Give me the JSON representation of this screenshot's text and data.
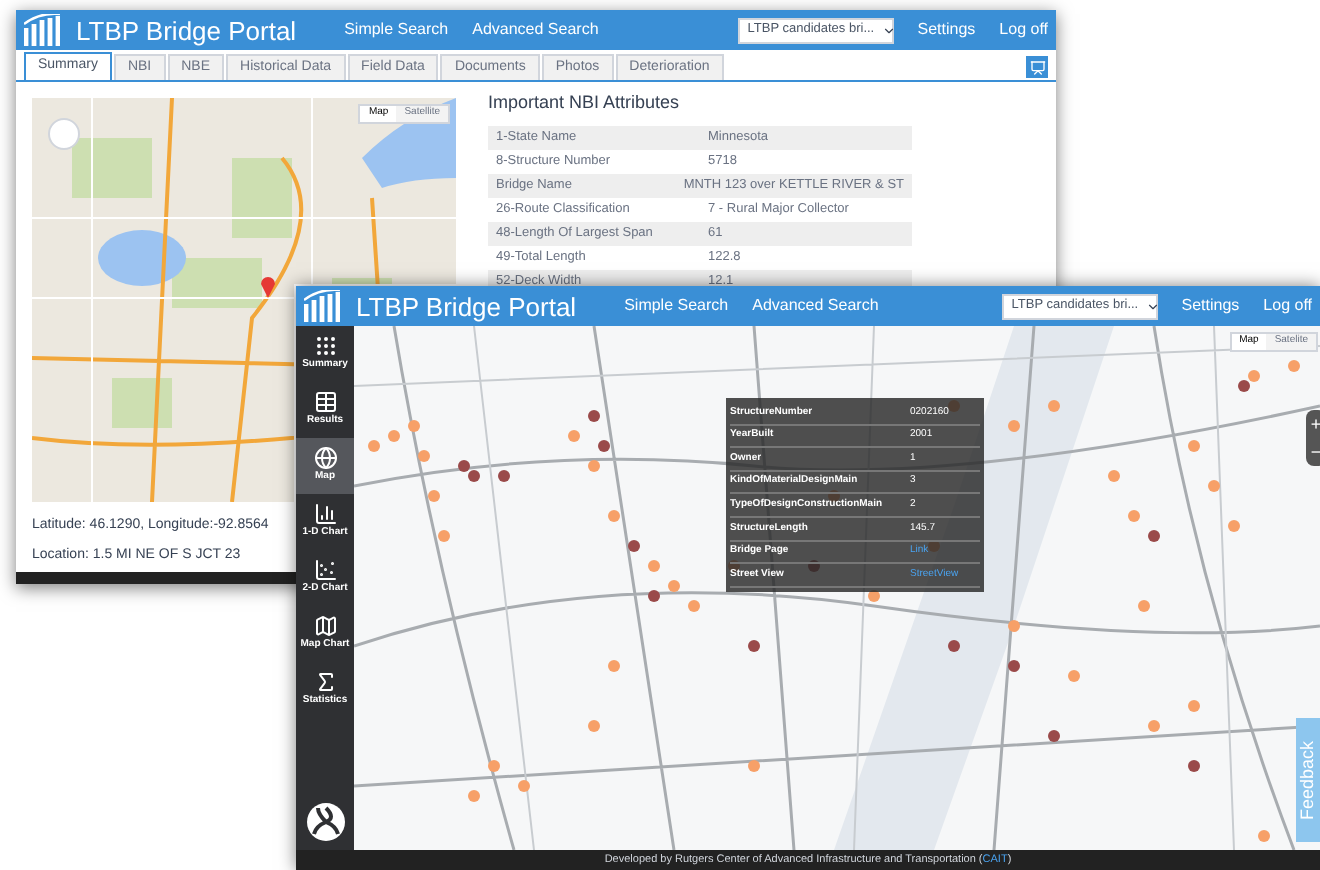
{
  "back_window": {
    "title": "LTBP Bridge Portal",
    "nav": [
      "Simple Search",
      "Advanced Search"
    ],
    "dataset_select": {
      "value": "LTBP candidates bri..."
    },
    "links": [
      "Settings",
      "Log off"
    ],
    "tabs": [
      {
        "label": "Summary",
        "selected": true
      },
      {
        "label": "NBI",
        "selected": false
      },
      {
        "label": "NBE",
        "selected": false
      },
      {
        "label": "Historical Data",
        "selected": false
      },
      {
        "label": "Field Data",
        "selected": false
      },
      {
        "label": "Documents",
        "selected": false
      },
      {
        "label": "Photos",
        "selected": false
      },
      {
        "label": "Deterioration",
        "selected": false
      }
    ],
    "map": {
      "map_types": [
        {
          "label": "Map",
          "selected": true
        },
        {
          "label": "Satellite",
          "selected": false
        }
      ]
    },
    "coordinates": "Latitude: 46.1290, Longitude:-92.8564",
    "location": "Location: 1.5 MI NE OF S JCT 23",
    "attributes": {
      "title": "Important NBI Attributes",
      "rows": [
        {
          "label": "1-State Name",
          "value": "Minnesota"
        },
        {
          "label": "8-Structure Number",
          "value": "5718"
        },
        {
          "label": "Bridge Name",
          "value": "MNTH 123 over KETTLE RIVER & ST"
        },
        {
          "label": "26-Route Classification",
          "value": "7 - Rural Major Collector"
        },
        {
          "label": "48-Length Of Largest Span",
          "value": "61"
        },
        {
          "label": "49-Total Length",
          "value": "122.8"
        },
        {
          "label": "52-Deck Width",
          "value": "12.1"
        }
      ]
    }
  },
  "front_window": {
    "title": "LTBP Bridge Portal",
    "nav": [
      "Simple Search",
      "Advanced Search"
    ],
    "dataset_select": {
      "value": "LTBP candidates bri..."
    },
    "links": [
      "Settings",
      "Log off"
    ],
    "sidebar": [
      {
        "label": "Summary",
        "selected": false
      },
      {
        "label": "Results",
        "selected": false
      },
      {
        "label": "Map",
        "selected": true
      },
      {
        "label": "1-D Chart",
        "selected": false
      },
      {
        "label": "2-D Chart",
        "selected": false
      },
      {
        "label": "Map Chart",
        "selected": false
      },
      {
        "label": "Statistics",
        "selected": false
      }
    ],
    "map": {
      "map_types": [
        {
          "label": "Map",
          "selected": true
        },
        {
          "label": "Satelite",
          "selected": false
        }
      ],
      "zoom": [
        "+",
        "−"
      ],
      "popup": [
        {
          "label": "StructureNumber",
          "value": "0202160",
          "kind": "text"
        },
        {
          "label": "YearBuilt",
          "value": "2001",
          "kind": "text"
        },
        {
          "label": "Owner",
          "value": "1",
          "kind": "text"
        },
        {
          "label": "KindOfMaterialDesignMain",
          "value": "3",
          "kind": "text"
        },
        {
          "label": "TypeOfDesignConstructionMain",
          "value": "2",
          "kind": "text"
        },
        {
          "label": "StructureLength",
          "value": "145.7",
          "kind": "text"
        },
        {
          "label": "Bridge Page",
          "value": "Link",
          "kind": "link"
        },
        {
          "label": "Street View",
          "value": "StreetView",
          "kind": "link"
        }
      ]
    },
    "feedback": "Feedback",
    "footer": {
      "text": "Developed by Rutgers Center of Advanced Infrastructure and Transportation (",
      "link": "CAIT",
      "end": ")"
    }
  }
}
